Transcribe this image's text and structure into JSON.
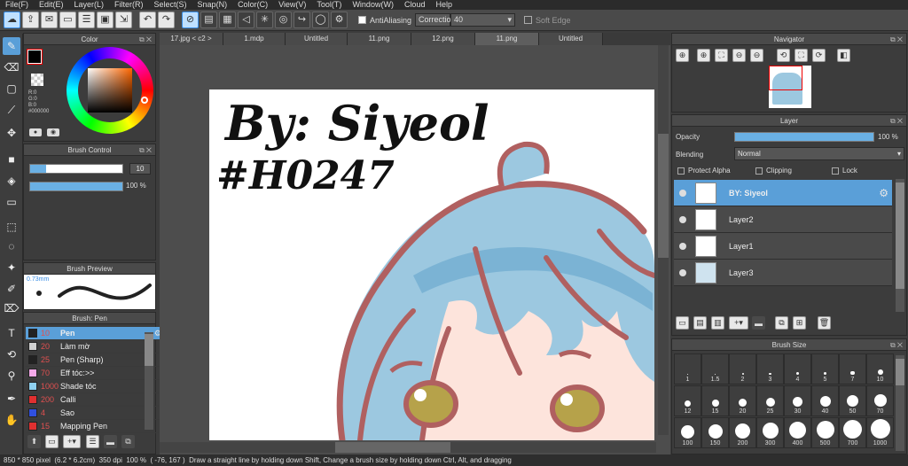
{
  "menu": [
    "File(F)",
    "Edit(E)",
    "Layer(L)",
    "Filter(R)",
    "Select(S)",
    "Snap(N)",
    "Color(C)",
    "View(V)",
    "Tool(T)",
    "Window(W)",
    "Cloud",
    "Help"
  ],
  "toolbar": {
    "antialiasing_label": "AntiAliasing",
    "correction_label": "Correction",
    "correction_value": "40",
    "soft_edge_label": "Soft Edge"
  },
  "tabs": [
    "17.jpg < c2 >",
    "1.mdp",
    "Untitled",
    "11.png",
    "12.png",
    "11.png",
    "Untitled"
  ],
  "color_panel": {
    "title": "Color",
    "r": "R:0",
    "g": "G:0",
    "b": "B:0",
    "hex": "#000000"
  },
  "brush_control": {
    "title": "Brush Control",
    "size_value": "10",
    "opacity_value": "100 %",
    "opacity_fill": 1.0
  },
  "brush_preview": {
    "title": "Brush Preview",
    "size_label": "0.73mm"
  },
  "brush_list": {
    "title": "Brush: Pen",
    "items": [
      {
        "size": "10",
        "name": "Pen",
        "color": "#222222"
      },
      {
        "size": "20",
        "name": "Làm mờ",
        "color": "#d0d0d0"
      },
      {
        "size": "25",
        "name": "Pen (Sharp)",
        "color": "#222222"
      },
      {
        "size": "70",
        "name": "Eff tóc:>>",
        "color": "#f4a8e8"
      },
      {
        "size": "1000",
        "name": "Shade tóc",
        "color": "#8fd0f0"
      },
      {
        "size": "200",
        "name": "Calli",
        "color": "#e03030"
      },
      {
        "size": "4",
        "name": "Sao",
        "color": "#3050e0"
      },
      {
        "size": "15",
        "name": "Mapping Pen",
        "color": "#e03030"
      }
    ]
  },
  "navigator": {
    "title": "Navigator"
  },
  "layer_panel": {
    "title": "Layer",
    "opacity_label": "Opacity",
    "opacity_value": "100 %",
    "opacity_fill": 1.0,
    "blending_label": "Blending",
    "blending_value": "Normal",
    "protect_alpha": "Protect Alpha",
    "clipping": "Clipping",
    "lock": "Lock",
    "layers": [
      {
        "name": "BY: Siyeol",
        "active": true
      },
      {
        "name": "Layer2",
        "active": false
      },
      {
        "name": "Layer1",
        "active": false
      },
      {
        "name": "Layer3",
        "active": false
      }
    ]
  },
  "brush_size": {
    "title": "Brush Size",
    "sizes": [
      "1",
      "1.5",
      "2",
      "3",
      "4",
      "5",
      "7",
      "10",
      "12",
      "15",
      "20",
      "25",
      "30",
      "40",
      "50",
      "70",
      "100",
      "150",
      "200",
      "300",
      "400",
      "500",
      "700",
      "1000"
    ]
  },
  "canvas_text": {
    "line1": "By: Siyeol",
    "line2": "#H0247"
  },
  "status": {
    "dimensions": "850 * 850 pixel",
    "physical": "(6.2 * 6.2cm)",
    "dpi": "350 dpi",
    "zoom": "100 %",
    "coords": "( -76, 167 )",
    "hint": "Draw a straight line by holding down Shift, Change a brush size by holding down Ctrl, Alt, and dragging"
  },
  "colors": {
    "accent": "#5a9fd8",
    "hair": "#9cc8e0",
    "outline": "#b06060",
    "skin": "#fde4dc"
  }
}
